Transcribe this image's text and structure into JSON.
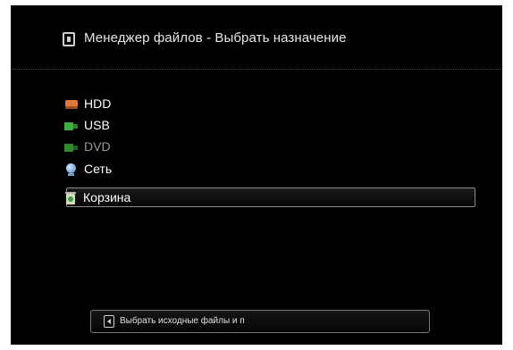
{
  "header": {
    "title": "Менеджер файлов - Выбрать назначение",
    "icon": "file-manager-icon"
  },
  "destinations": [
    {
      "label": "HDD",
      "icon": "hdd-icon",
      "enabled": true,
      "selected": false
    },
    {
      "label": "USB",
      "icon": "usb-icon",
      "enabled": true,
      "selected": false
    },
    {
      "label": "DVD",
      "icon": "dvd-icon",
      "enabled": false,
      "selected": false
    },
    {
      "label": "Сеть",
      "icon": "network-icon",
      "enabled": true,
      "selected": false
    },
    {
      "label": "Корзина",
      "icon": "trash-icon",
      "enabled": true,
      "selected": true
    }
  ],
  "hint": {
    "text": "Выбрать исходные файлы и п",
    "key_icon": "left-arrow-key-icon"
  },
  "colors": {
    "background": "#000000",
    "divider": "#8a2a2a",
    "text": "#ffffff",
    "disabled_text": "#9a9a9a",
    "selection_border": "#8c8c8c"
  }
}
